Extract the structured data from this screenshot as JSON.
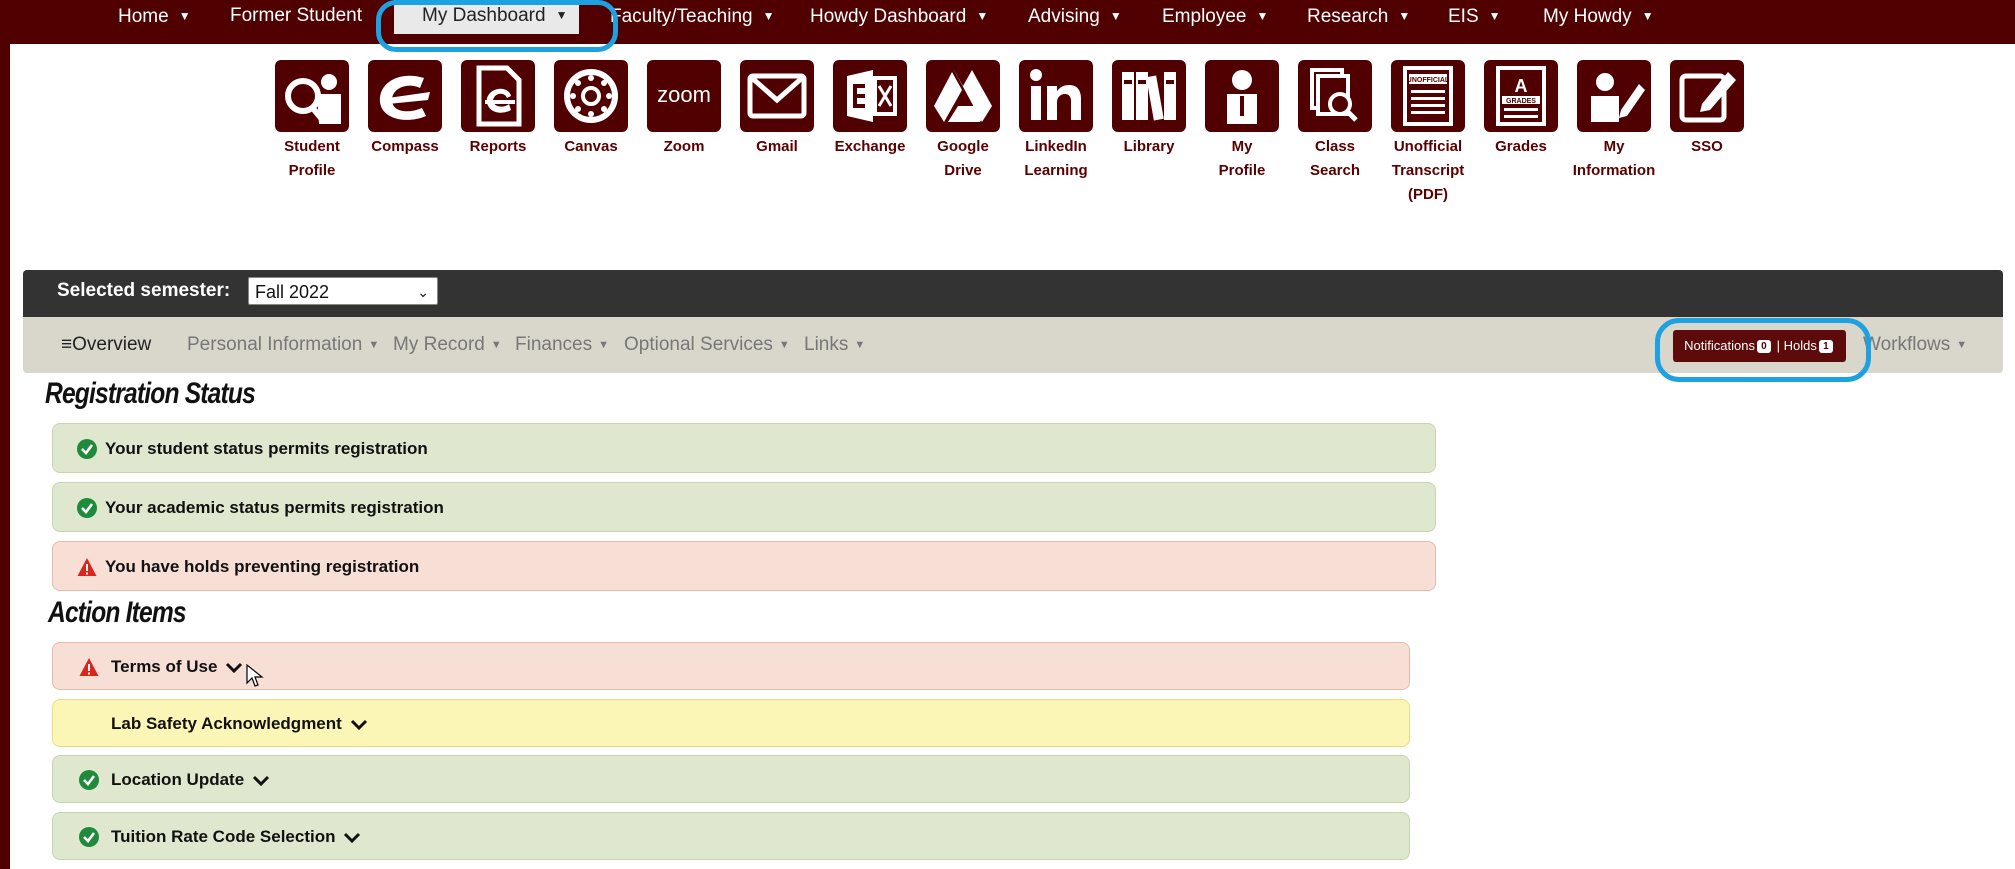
{
  "topnav": {
    "items": [
      {
        "label": "Home"
      },
      {
        "label": "Former Student"
      },
      {
        "label": "My Dashboard"
      },
      {
        "label": "Faculty/Teaching"
      },
      {
        "label": "Howdy Dashboard"
      },
      {
        "label": "Advising"
      },
      {
        "label": "Employee"
      },
      {
        "label": "Research"
      },
      {
        "label": "EIS"
      },
      {
        "label": "My Howdy"
      }
    ],
    "caret": "▼"
  },
  "apps": [
    {
      "label1": "Student",
      "label2": "Profile",
      "icon": "student-profile-icon"
    },
    {
      "label1": "Compass",
      "label2": "",
      "icon": "compass-icon"
    },
    {
      "label1": "Reports",
      "label2": "",
      "icon": "reports-icon"
    },
    {
      "label1": "Canvas",
      "label2": "",
      "icon": "canvas-icon"
    },
    {
      "label1": "Zoom",
      "label2": "",
      "icon": "zoom-icon"
    },
    {
      "label1": "Gmail",
      "label2": "",
      "icon": "gmail-icon"
    },
    {
      "label1": "Exchange",
      "label2": "",
      "icon": "exchange-icon"
    },
    {
      "label1": "Google",
      "label2": "Drive",
      "icon": "google-drive-icon"
    },
    {
      "label1": "LinkedIn",
      "label2": "Learning",
      "icon": "linkedin-icon"
    },
    {
      "label1": "Library",
      "label2": "",
      "icon": "library-icon"
    },
    {
      "label1": "My",
      "label2": "Profile",
      "icon": "my-profile-icon"
    },
    {
      "label1": "Class",
      "label2": "Search",
      "icon": "class-search-icon"
    },
    {
      "label1": "Unofficial",
      "label2": "Transcript",
      "label3": "(PDF)",
      "icon": "transcript-icon"
    },
    {
      "label1": "Grades",
      "label2": "",
      "icon": "grades-icon"
    },
    {
      "label1": "My",
      "label2": "Information",
      "icon": "my-information-icon"
    },
    {
      "label1": "SSO",
      "label2": "",
      "icon": "sso-icon"
    }
  ],
  "app_tile_text": {
    "zoom": "zoom",
    "unofficial": "UNOFFICIAL",
    "grades_tag": "GRADES",
    "grades_letter": "A"
  },
  "semester": {
    "label": "Selected semester:",
    "selected": "Fall 2022"
  },
  "subnav": {
    "overview": "Overview",
    "items": [
      "Personal Information",
      "My Record",
      "Finances",
      "Optional Services",
      "Links"
    ],
    "notifications_label": "Notifications",
    "notifications_count": "0",
    "separator": "|",
    "holds_label": "Holds",
    "holds_count": "1",
    "workflows": "Workflows"
  },
  "registration": {
    "title": "Registration Status",
    "rows": [
      {
        "text": "Your student status permits registration",
        "status": "ok"
      },
      {
        "text": "Your academic status permits registration",
        "status": "ok"
      },
      {
        "text": "You have holds preventing registration",
        "status": "bad"
      }
    ]
  },
  "actions": {
    "title": "Action Items",
    "rows": [
      {
        "text": "Terms of Use",
        "status": "bad"
      },
      {
        "text": "Lab Safety Acknowledgment",
        "status": "warn"
      },
      {
        "text": "Location Update",
        "status": "ok"
      },
      {
        "text": "Tuition Rate Code Selection",
        "status": "ok"
      }
    ]
  },
  "colors": {
    "maroon": "#500000",
    "highlight": "#1ea1e0",
    "ok_green": "#1f8a3b",
    "alert_red": "#d8261c"
  }
}
